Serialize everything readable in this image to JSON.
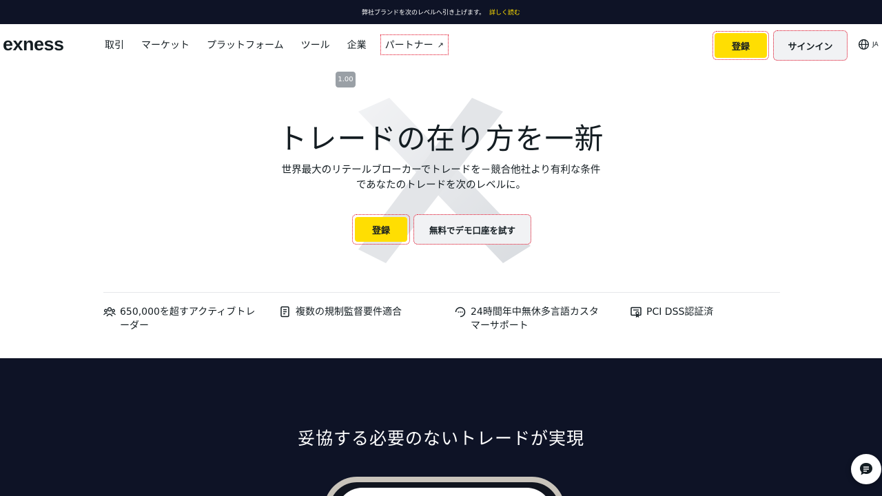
{
  "announcement": {
    "text": "弊社ブランドを次のレベルへ引き上げます。",
    "link": "詳しく読む"
  },
  "header": {
    "logo": "exness",
    "nav": [
      {
        "label": "取引"
      },
      {
        "label": "マーケット"
      },
      {
        "label": "プラットフォーム"
      },
      {
        "label": "ツール"
      },
      {
        "label": "企業"
      },
      {
        "label": "パートナー",
        "icon": "external-arrow-icon"
      }
    ],
    "register_label": "登録",
    "signin_label": "サインイン",
    "language": "JA",
    "language_icon": "globe-icon"
  },
  "zoom_badge": "1.00",
  "hero": {
    "title": "トレードの在り方を一新",
    "subtitle_line1": "世界最大のリテールブローカーでトレードを－競合他社より有利な条件",
    "subtitle_line2": "であなたのトレードを次のレベルに。",
    "register_label": "登録",
    "demo_label": "無料でデモ口座を試す"
  },
  "features": [
    {
      "icon": "users-icon",
      "text": "650,000を超すアクティブトレーダー"
    },
    {
      "icon": "document-icon",
      "text": "複数の規制監督要件適合"
    },
    {
      "icon": "support-icon",
      "text": "24時間年中無休多言語カスタマーサポート"
    },
    {
      "icon": "certificate-icon",
      "text": "PCI DSS認証済"
    }
  ],
  "section2": {
    "title": "妥協する必要のないトレードが実現"
  },
  "chat_icon": "chat-bubble-icon",
  "colors": {
    "brand_yellow": "#ffde02",
    "dark_bg": "#0e1326",
    "button_grey": "#f1f2f4",
    "highlight_red": "#e0001b"
  }
}
